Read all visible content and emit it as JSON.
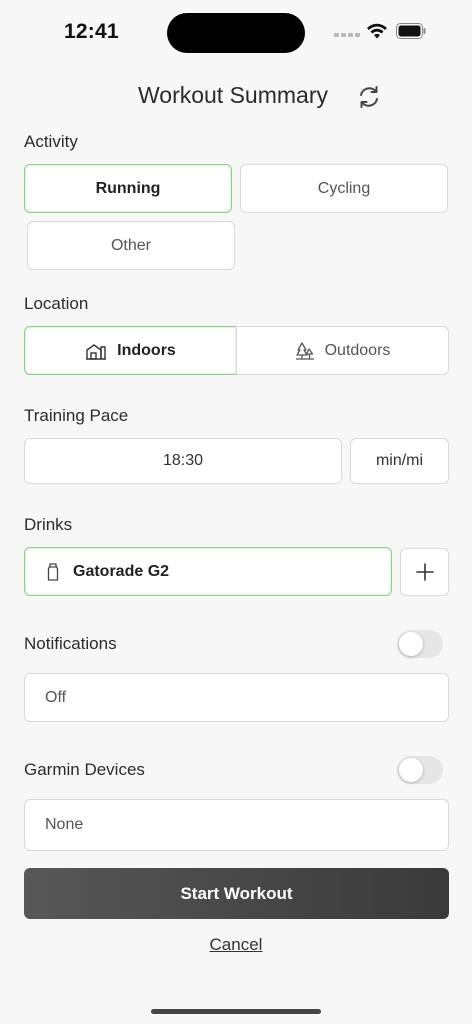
{
  "status_bar": {
    "time": "12:41"
  },
  "header": {
    "title": "Workout Summary",
    "refresh_icon": "refresh-icon"
  },
  "activity": {
    "label": "Activity",
    "options": [
      "Running",
      "Cycling",
      "Other"
    ],
    "selected": "Running"
  },
  "location": {
    "label": "Location",
    "options": [
      "Indoors",
      "Outdoors"
    ],
    "selected": "Indoors",
    "icons": [
      "indoors-building-icon",
      "outdoors-trees-icon"
    ]
  },
  "pace": {
    "label": "Training Pace",
    "value": "18:30",
    "unit": "min/mi"
  },
  "drinks": {
    "label": "Drinks",
    "value": "Gatorade G2",
    "icon": "bottle-icon",
    "add_icon": "plus-icon"
  },
  "notifications": {
    "label": "Notifications",
    "enabled": false,
    "value": "Off"
  },
  "garmin": {
    "label": "Garmin Devices",
    "enabled": false,
    "value": "None"
  },
  "actions": {
    "start_label": "Start Workout",
    "cancel_label": "Cancel"
  },
  "colors": {
    "selected_border": "#8fd18a",
    "primary_button": "#4a4a4a",
    "background": "#f7f7f7"
  }
}
